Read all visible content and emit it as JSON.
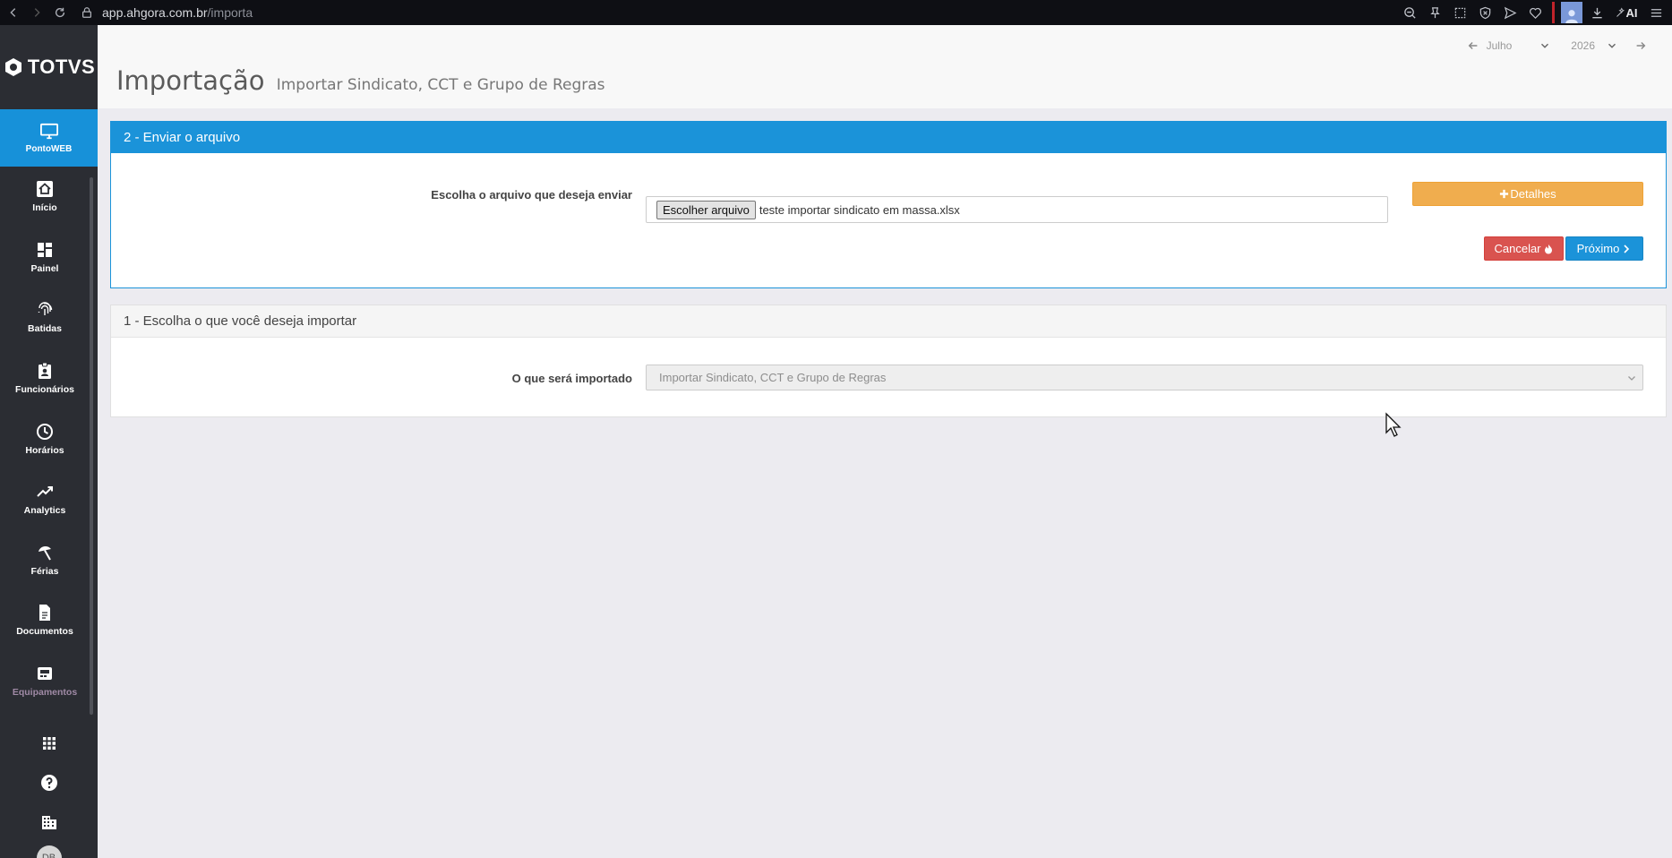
{
  "browser": {
    "url_host": "app.ahgora.com.br",
    "url_path": "/importa",
    "ai_label": "AI"
  },
  "sidebar": {
    "logo_text": "TOTVS",
    "active_item": "PontoWEB",
    "items": [
      {
        "label": "Início",
        "icon": "home-icon"
      },
      {
        "label": "Painel",
        "icon": "dashboard-icon"
      },
      {
        "label": "Batidas",
        "icon": "fingerprint-icon"
      },
      {
        "label": "Funcionários",
        "icon": "badge-icon"
      },
      {
        "label": "Horários",
        "icon": "clock-icon"
      },
      {
        "label": "Analytics",
        "icon": "trending-icon"
      },
      {
        "label": "Férias",
        "icon": "beach-umbrella-icon"
      },
      {
        "label": "Documentos",
        "icon": "document-icon"
      },
      {
        "label": "Equipamentos",
        "icon": "device-icon"
      }
    ],
    "user_initials": "DB"
  },
  "header": {
    "title": "Importação",
    "subtitle": "Importar Sindicato, CCT e Grupo de Regras",
    "month": "Julho",
    "year": "2026"
  },
  "step2": {
    "title": "2 - Enviar o arquivo",
    "file_label": "Escolha o arquivo que deseja enviar",
    "file_button": "Escolher arquivo",
    "file_name": "teste importar sindicato em massa.xlsx",
    "details_button": "Detalhes",
    "cancel_button": "Cancelar",
    "next_button": "Próximo"
  },
  "step1": {
    "title": "1 - Escolha o que você deseja importar",
    "select_label": "O que será importado",
    "select_value": "Importar Sindicato, CCT e Grupo de Regras"
  },
  "colors": {
    "primary": "#1b93d9",
    "warning": "#f0ad4e",
    "danger": "#d9534f",
    "sidebar": "#2b2d33"
  }
}
